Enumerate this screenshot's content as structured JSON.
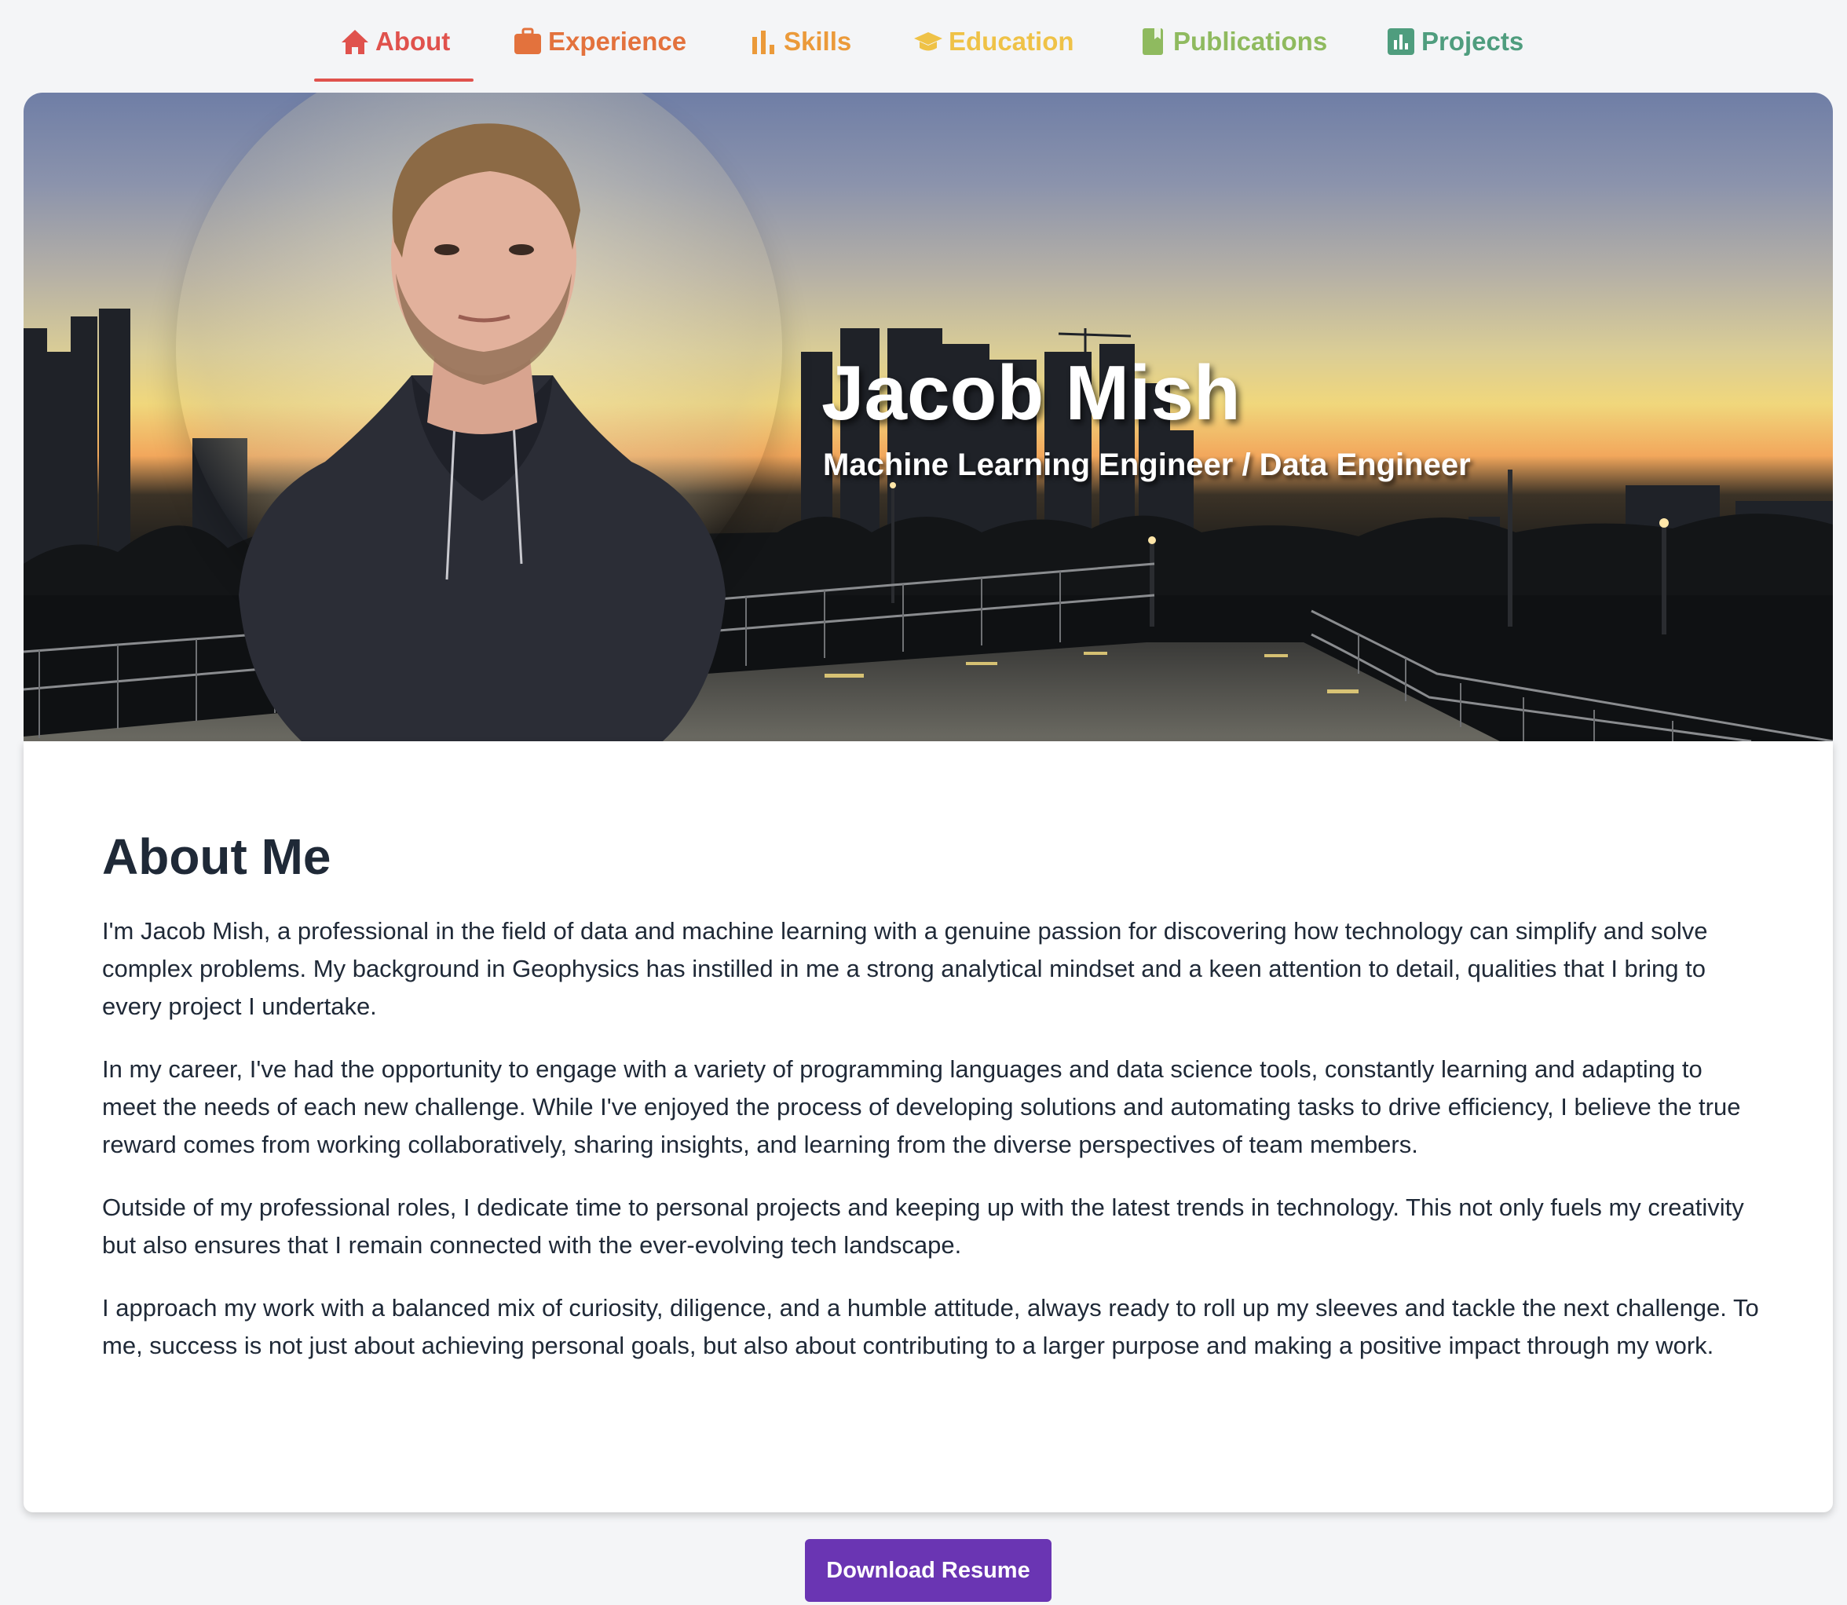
{
  "nav": {
    "items": [
      {
        "label": "About",
        "icon": "home-icon",
        "active": true,
        "color": "#e0524d"
      },
      {
        "label": "Experience",
        "icon": "briefcase-icon",
        "active": false,
        "color": "#e3723d"
      },
      {
        "label": "Skills",
        "icon": "bar-chart-icon",
        "active": false,
        "color": "#eb9a3a"
      },
      {
        "label": "Education",
        "icon": "graduation-cap-icon",
        "active": false,
        "color": "#efc247"
      },
      {
        "label": "Publications",
        "icon": "book-icon",
        "active": false,
        "color": "#8fba5f"
      },
      {
        "label": "Projects",
        "icon": "chart-square-icon",
        "active": false,
        "color": "#4f9d7e"
      }
    ]
  },
  "hero": {
    "name": "Jacob Mish",
    "title": "Machine Learning Engineer / Data Engineer"
  },
  "about": {
    "heading": "About Me",
    "paragraphs": [
      "I'm Jacob Mish, a professional in the field of data and machine learning with a genuine passion for discovering how technology can simplify and solve complex problems. My background in Geophysics has instilled in me a strong analytical mindset and a keen attention to detail, qualities that I bring to every project I undertake.",
      "In my career, I've had the opportunity to engage with a variety of programming languages and data science tools, constantly learning and adapting to meet the needs of each new challenge. While I've enjoyed the process of developing solutions and automating tasks to drive efficiency, I believe the true reward comes from working collaboratively, sharing insights, and learning from the diverse perspectives of team members.",
      "Outside of my professional roles, I dedicate time to personal projects and keeping up with the latest trends in technology. This not only fuels my creativity but also ensures that I remain connected with the ever-evolving tech landscape.",
      "I approach my work with a balanced mix of curiosity, diligence, and a humble attitude, always ready to roll up my sleeves and tackle the next challenge. To me, success is not just about achieving personal goals, but also about contributing to a larger purpose and making a positive impact through my work."
    ]
  },
  "download_button": {
    "label": "Download Resume",
    "color": "#6a35b3"
  }
}
